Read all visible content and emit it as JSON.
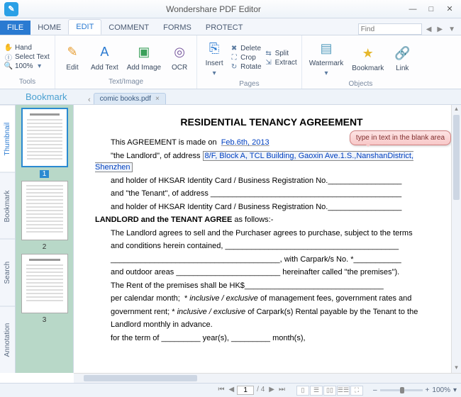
{
  "titlebar": {
    "app_title": "Wondershare PDF Editor",
    "logo_letter": "✎"
  },
  "window_controls": {
    "min": "—",
    "max": "□",
    "close": "✕"
  },
  "menu_tabs": {
    "file": "FILE",
    "home": "HOME",
    "edit": "EDIT",
    "comment": "COMMENT",
    "forms": "FORMS",
    "protect": "PROTECT"
  },
  "search": {
    "placeholder": "Find"
  },
  "ribbon": {
    "tools": {
      "label": "Tools",
      "hand": "Hand",
      "select_text": "Select Text",
      "zoom": "100%"
    },
    "textimage": {
      "label": "Text/Image",
      "edit": "Edit",
      "add_text": "Add Text",
      "add_image": "Add Image",
      "ocr": "OCR"
    },
    "pages": {
      "label": "Pages",
      "insert": "Insert",
      "delete": "Delete",
      "crop": "Crop",
      "rotate": "Rotate",
      "split": "Split",
      "extract": "Extract"
    },
    "objects": {
      "label": "Objects",
      "watermark": "Watermark",
      "bookmark": "Bookmark",
      "link": "Link"
    }
  },
  "bookmark_panel_label": "Bookmark",
  "doc_tab": {
    "name": "comic books.pdf"
  },
  "side_tabs": {
    "thumbnail": "Thumbnail",
    "bookmark": "Bookmark",
    "search": "Search",
    "annotation": "Annotation"
  },
  "thumbnails": {
    "p1": "1",
    "p2": "2",
    "p3": "3"
  },
  "callout": {
    "text": "type in text in the blank area"
  },
  "document": {
    "title": "RESIDENTIAL TENANCY AGREEMENT",
    "line_agreement": "This AGREEMENT is made on",
    "date_value": "Feb.6th, 2013",
    "landlord_prefix": "\"the Landlord\", of address",
    "landlord_address": "8/F, Block A, TCL Building, Gaoxin Ave.1.S.,NanshanDistrict, Shenzhen",
    "hksar1": "and holder of HKSAR Identity Card / Business Registration No._________________",
    "tenant_line": "and \"the Tenant\", of address ____________________________________________",
    "hksar2": "and holder of HKSAR Identity Card / Business Registration No._________________",
    "agree_header": "LANDLORD and the TENANT AGREE",
    "agree_suffix": " as follows:-",
    "p1a": "The Landlord agrees to sell and the Purchaser agrees to purchase, subject to the terms",
    "p1b": "and conditions herein contained, ________________________________________",
    "p1c": "_______________________________________, with Carpark/s No. *___________",
    "p1d": "and outdoor areas ________________________ hereinafter called \"the premises\").",
    "rent": "The Rent of the premises shall be HK$________________________________",
    "p2a": "per calendar month;  * inclusive / exclusive of management fees, government rates and",
    "p2b": "government rent; * inclusive / exclusive of Carpark(s) Rental payable by the Tenant to the",
    "p2c": "Landlord monthly in advance.",
    "term": "for the term of _________ year(s), _________ month(s),"
  },
  "status": {
    "page_current": "1",
    "page_total": "/ 4",
    "zoom": "100%",
    "zm_minus": "–",
    "zm_plus": "+"
  }
}
